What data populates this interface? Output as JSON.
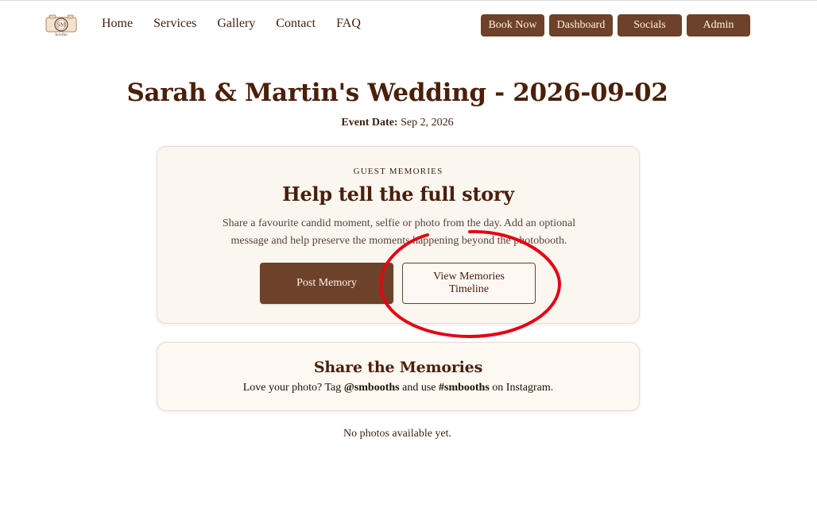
{
  "nav": {
    "logo": {
      "text": "SM",
      "subtext": "booths"
    },
    "links": [
      "Home",
      "Services",
      "Gallery",
      "Contact",
      "FAQ"
    ],
    "buttons": [
      "Book Now",
      "Dashboard",
      "Socials",
      "Admin"
    ]
  },
  "event": {
    "title": "Sarah & Martin's Wedding - 2026-09-02",
    "date_label": "Event Date:",
    "date_value": "Sep 2, 2026"
  },
  "memories": {
    "eyebrow": "GUEST MEMORIES",
    "heading": "Help tell the full story",
    "description": "Share a favourite candid moment, selfie or photo from the day. Add an optional message and help preserve the moments happening beyond the photobooth.",
    "post_button": "Post Memory",
    "view_button": "View Memories Timeline"
  },
  "share": {
    "heading": "Share the Memories",
    "text_before": "Love your photo? Tag ",
    "handle": "@smbooths",
    "text_middle": " and use ",
    "hashtag": "#smbooths",
    "text_after": " on Instagram."
  },
  "gallery": {
    "empty_message": "No photos available yet."
  },
  "colors": {
    "brand": "#6e412a",
    "heading": "#4a200a",
    "card_bg": "#fcf6f1",
    "annotation": "#e30613"
  }
}
